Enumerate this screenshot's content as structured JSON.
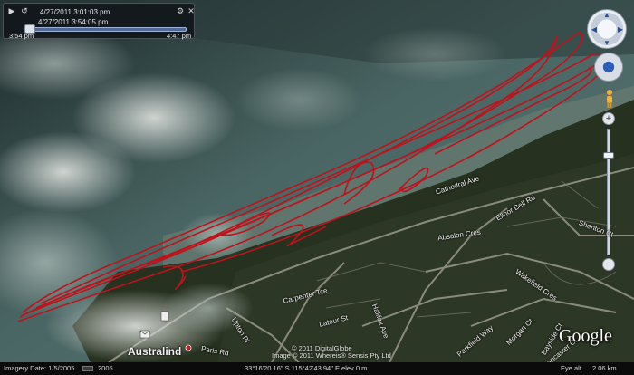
{
  "time_slider": {
    "range_start": "4/27/2011  3:01:03 pm",
    "range_end": "4/27/2011  3:54:05 pm",
    "slider_start": "3:54 pm",
    "slider_end": "4:47 pm"
  },
  "map_labels": {
    "town": "Australind",
    "roads": [
      "Cathedral Ave",
      "Ellnor Bell Rd",
      "Absalon Cres",
      "Wakefield Cres",
      "Shenton Ct",
      "Carpenter Tce",
      "Latour St",
      "Halifax Ave",
      "Upton Pl",
      "Paris Rd",
      "Parkfield Way",
      "Morgan Ct",
      "Bayside Ct",
      "Lancaster Ct"
    ]
  },
  "attribution": {
    "line1": "Image © 2011 Whereis® Sensis Pty Ltd",
    "line2": "© 2011 DigitalGlobe",
    "logo": "Google"
  },
  "status_bar": {
    "imagery_date_label": "Imagery Date: 1/5/2005",
    "year": "2005",
    "coordinates": "33°16'20.16\" S  115°42'43.94\" E  elev   0 m",
    "eye_alt_label": "Eye alt",
    "eye_alt_value": "2.06 km"
  },
  "icons": [
    "play-icon",
    "rewind-icon",
    "settings-wrench-icon",
    "close-icon",
    "compass-ring-icon",
    "look-joystick-icon",
    "pegman-icon",
    "zoom-in-icon",
    "zoom-out-icon",
    "mail-poi-icon",
    "fuel-poi-icon",
    "place-marker-icon"
  ],
  "colors": {
    "track": "#c0121a",
    "water": "#3f5b5a",
    "land": "#25301f"
  }
}
